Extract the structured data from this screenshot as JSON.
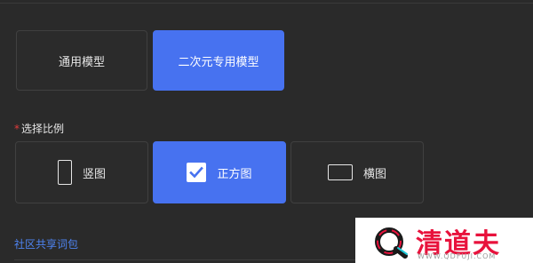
{
  "model_options": [
    {
      "label": "通用模型",
      "selected": false
    },
    {
      "label": "二次元专用模型",
      "selected": true
    }
  ],
  "ratio_section": {
    "required_mark": "*",
    "label": "选择比例"
  },
  "ratio_options": [
    {
      "label": "竖图",
      "icon": "portrait-icon",
      "selected": false
    },
    {
      "label": "正方图",
      "icon": "checkbox-checked-icon",
      "selected": true
    },
    {
      "label": "横图",
      "icon": "landscape-icon",
      "selected": false
    }
  ],
  "community_link": "社区共享词包",
  "watermark": {
    "brand": "清道夫",
    "url": "WWW.QDFUJI.COM"
  },
  "colors": {
    "accent": "#4772f0",
    "background": "#2a2a2a",
    "link": "#4e84f2",
    "required": "#e23b3b",
    "watermark_red": "#e8123c"
  }
}
